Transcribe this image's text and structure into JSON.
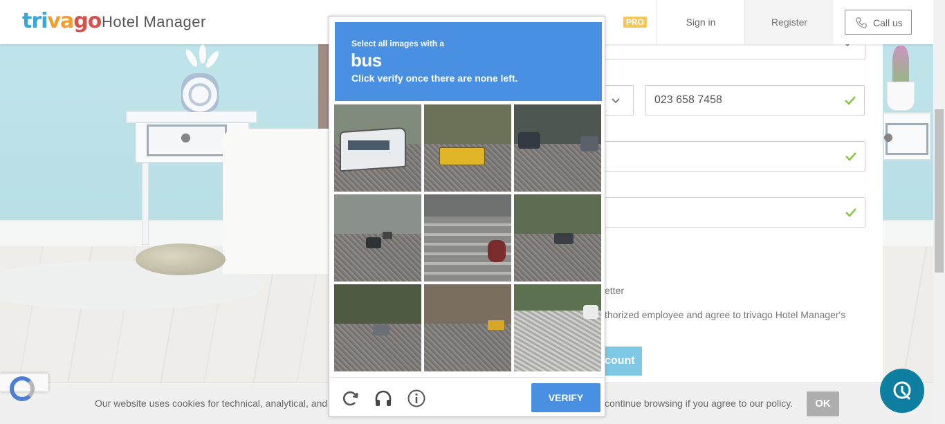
{
  "header": {
    "logo_part1": "tri",
    "logo_part2": "va",
    "logo_part3": "go",
    "logo_subtitle": "Hotel Manager",
    "pro_badge": "PRO",
    "signin_label": "Sign in",
    "register_label": "Register",
    "callus_label": "Call us",
    "callus_icon": "phone-icon"
  },
  "form": {
    "phone_value": "023 658 7458",
    "partial_newsletter_text": "etter",
    "partial_consent_text": "thorized employee and agree to trivago Hotel Manager's",
    "partial_button_text": "count"
  },
  "captcha": {
    "instruction_line1": "Select all images with a",
    "target_object": "bus",
    "instruction_line3": "Click verify once there are none left.",
    "verify_label": "VERIFY",
    "icons": [
      "reload-icon",
      "audio-icon",
      "info-icon"
    ],
    "accent_color": "#4a90e2"
  },
  "cookie": {
    "text_left": "Our website uses cookies for technical, analytical, and",
    "text_right": "continue browsing if you agree to our policy.",
    "ok_label": "OK"
  },
  "colors": {
    "logo_blue": "#37a8d6",
    "logo_orange": "#f29e2e",
    "logo_red": "#d8524b",
    "pro_yellow": "#f4c55a",
    "chat_teal": "#0e7fa1",
    "check_green": "#8bc34a"
  }
}
